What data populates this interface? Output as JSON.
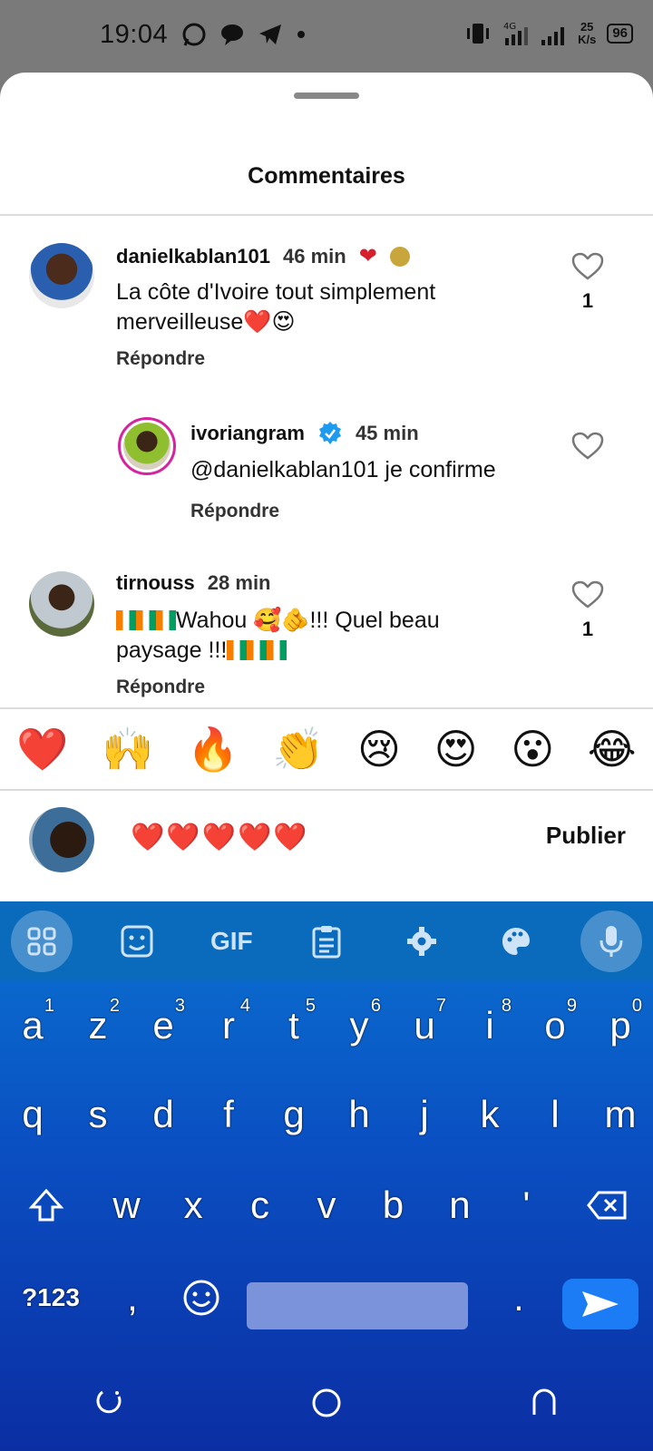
{
  "status_bar": {
    "time": "19:04",
    "speed_top": "25",
    "speed_bottom": "K/s",
    "battery": "96",
    "network": "4G"
  },
  "sheet": {
    "title": "Commentaires"
  },
  "comments": [
    {
      "username": "danielkablan101",
      "time": "46 min",
      "text": "La côte d'Ivoire tout simplement merveilleuse❤️😍",
      "reply": "Répondre",
      "likes": "1"
    },
    {
      "username": "ivoriangram",
      "time": "45 min",
      "text": "@danielkablan101 je confirme",
      "reply": "Répondre",
      "likes": ""
    },
    {
      "username": "tirnouss",
      "time": "28 min",
      "text_a": "Wahou 🥰🫵!!! Quel beau",
      "text_b": "paysage !!!",
      "reply": "Répondre",
      "likes": "1"
    }
  ],
  "emoji_bar": [
    "❤️",
    "🙌",
    "🔥",
    "👏",
    "😢",
    "😍",
    "😮",
    "😂"
  ],
  "composer": {
    "input_value": "❤️❤️❤️❤️❤️",
    "publish_label": "Publier"
  },
  "keyboard": {
    "gif_label": "GIF",
    "row1": [
      {
        "k": "a",
        "n": "1"
      },
      {
        "k": "z",
        "n": "2"
      },
      {
        "k": "e",
        "n": "3"
      },
      {
        "k": "r",
        "n": "4"
      },
      {
        "k": "t",
        "n": "5"
      },
      {
        "k": "y",
        "n": "6"
      },
      {
        "k": "u",
        "n": "7"
      },
      {
        "k": "i",
        "n": "8"
      },
      {
        "k": "o",
        "n": "9"
      },
      {
        "k": "p",
        "n": "0"
      }
    ],
    "row2": [
      "q",
      "s",
      "d",
      "f",
      "g",
      "h",
      "j",
      "k",
      "l",
      "m"
    ],
    "row3": [
      "w",
      "x",
      "c",
      "v",
      "b",
      "n",
      "'"
    ],
    "symbols_label": "?123",
    "comma": ",",
    "period": "."
  }
}
